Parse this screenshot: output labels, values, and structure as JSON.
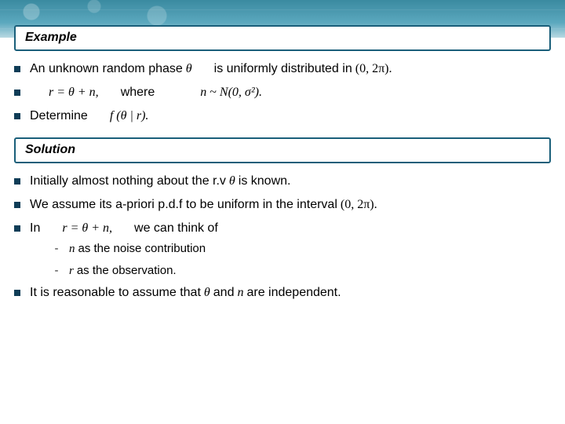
{
  "example_label": "Example",
  "p1a": "An unknown random phase",
  "p1_theta": "θ",
  "p1b": "is uniformly distributed in",
  "p1_interval": "(0, 2π).",
  "p2_eq": "r = θ + n,",
  "p2_where": "where",
  "p2_nvar": "n",
  "p2_tilde": "~",
  "p2_dist": "N(0, σ²).",
  "p3a": "Determine",
  "p3_fn": "f (θ | r).",
  "solution_label": "Solution",
  "s1a": "Initially almost nothing about the r.v",
  "s1_theta": "θ",
  "s1b": "is known.",
  "s2a": "We assume its a-priori p.d.f to be uniform in the interval",
  "s2_interval": "(0, 2π).",
  "s3a": "In",
  "s3_eq": "r = θ + n,",
  "s3b": "we can think of",
  "s3_sub1_n": "n",
  "s3_sub1_t": "as the noise contribution",
  "s3_sub2_r": "r",
  "s3_sub2_t": "as the observation.",
  "s4a": "It is reasonable to assume that",
  "s4_theta": "θ",
  "s4_and": "and",
  "s4_n": "n",
  "s4b": "are independent."
}
